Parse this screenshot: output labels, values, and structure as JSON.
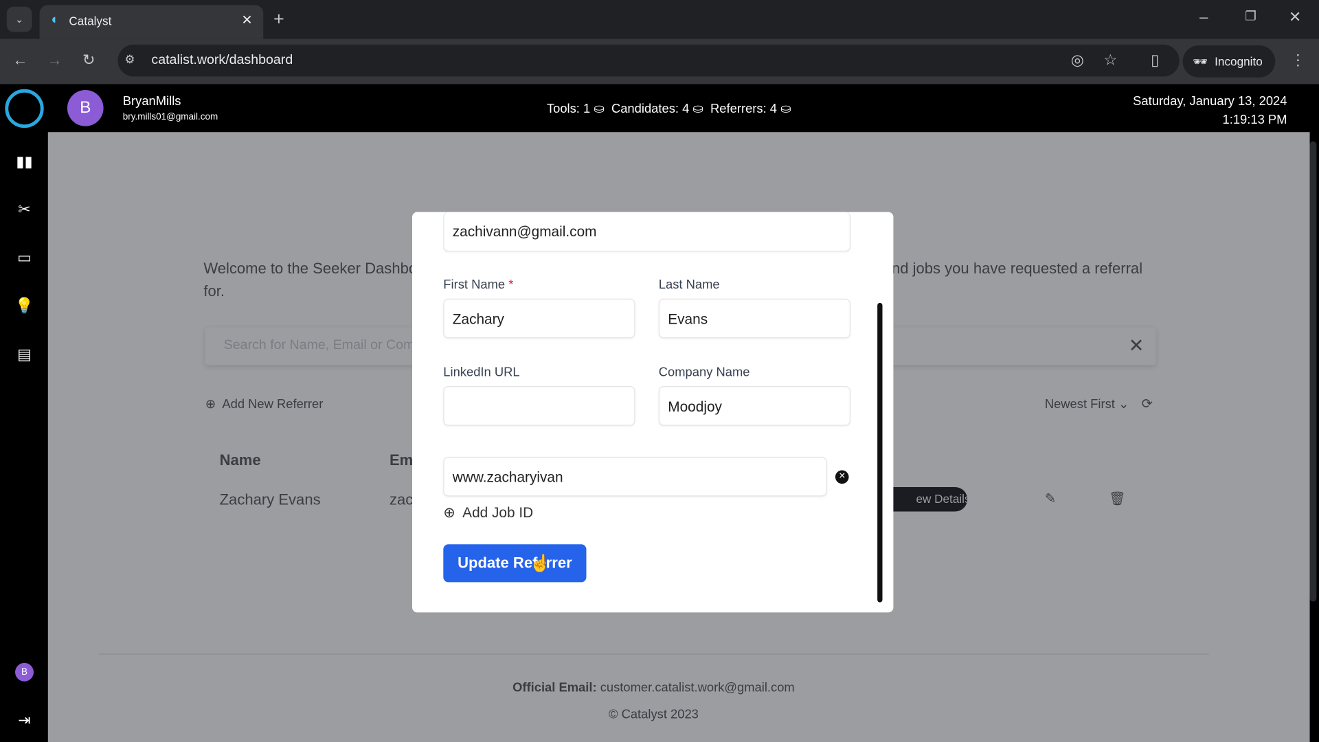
{
  "browser": {
    "tab_title": "Catalyst",
    "url": "catalist.work/dashboard",
    "incognito_label": "Incognito"
  },
  "header": {
    "avatar_letter": "B",
    "username": "BryanMills",
    "email": "bry.mills01@gmail.com",
    "tools": "Tools: 1",
    "candidates": "Candidates: 4",
    "referrers": "Referrers: 4",
    "date": "Saturday, January 13, 2024",
    "time": "1:19:13 PM"
  },
  "sidebar": {
    "items": [
      "dashboard-chart",
      "tools",
      "card",
      "ideas",
      "messages"
    ],
    "avatar_letter": "B"
  },
  "page": {
    "welcome_left": "Welcome to the Seeker Dashbo",
    "welcome_right": "nd jobs you have requested a referral",
    "welcome_wrap": "for.",
    "search_placeholder": "Search for Name, Email or Com",
    "add_referrer": "Add New Referrer",
    "sort": "Newest First",
    "col_name": "Name",
    "col_email": "Em",
    "row_name": "Zachary Evans",
    "row_email": "zac",
    "view_details": "ew Details"
  },
  "modal": {
    "email_value": "zachivann@gmail.com",
    "first_name_label": "First Name",
    "required": "*",
    "first_name": "Zachary",
    "last_name_label": "Last Name",
    "last_name": "Evans",
    "linkedin_label": "LinkedIn URL",
    "linkedin": "",
    "company_label": "Company Name",
    "company": "Moodjoy",
    "job_value": "www.zacharyivan",
    "add_job": "Add Job ID",
    "submit": "Update Referrer"
  },
  "footer": {
    "email_label": "Official Email:",
    "email": "customer.catalist.work@gmail.com",
    "copyright": "© Catalyst 2023"
  },
  "colors": {
    "accent": "#2563eb",
    "avatar": "#8b5cd6"
  }
}
